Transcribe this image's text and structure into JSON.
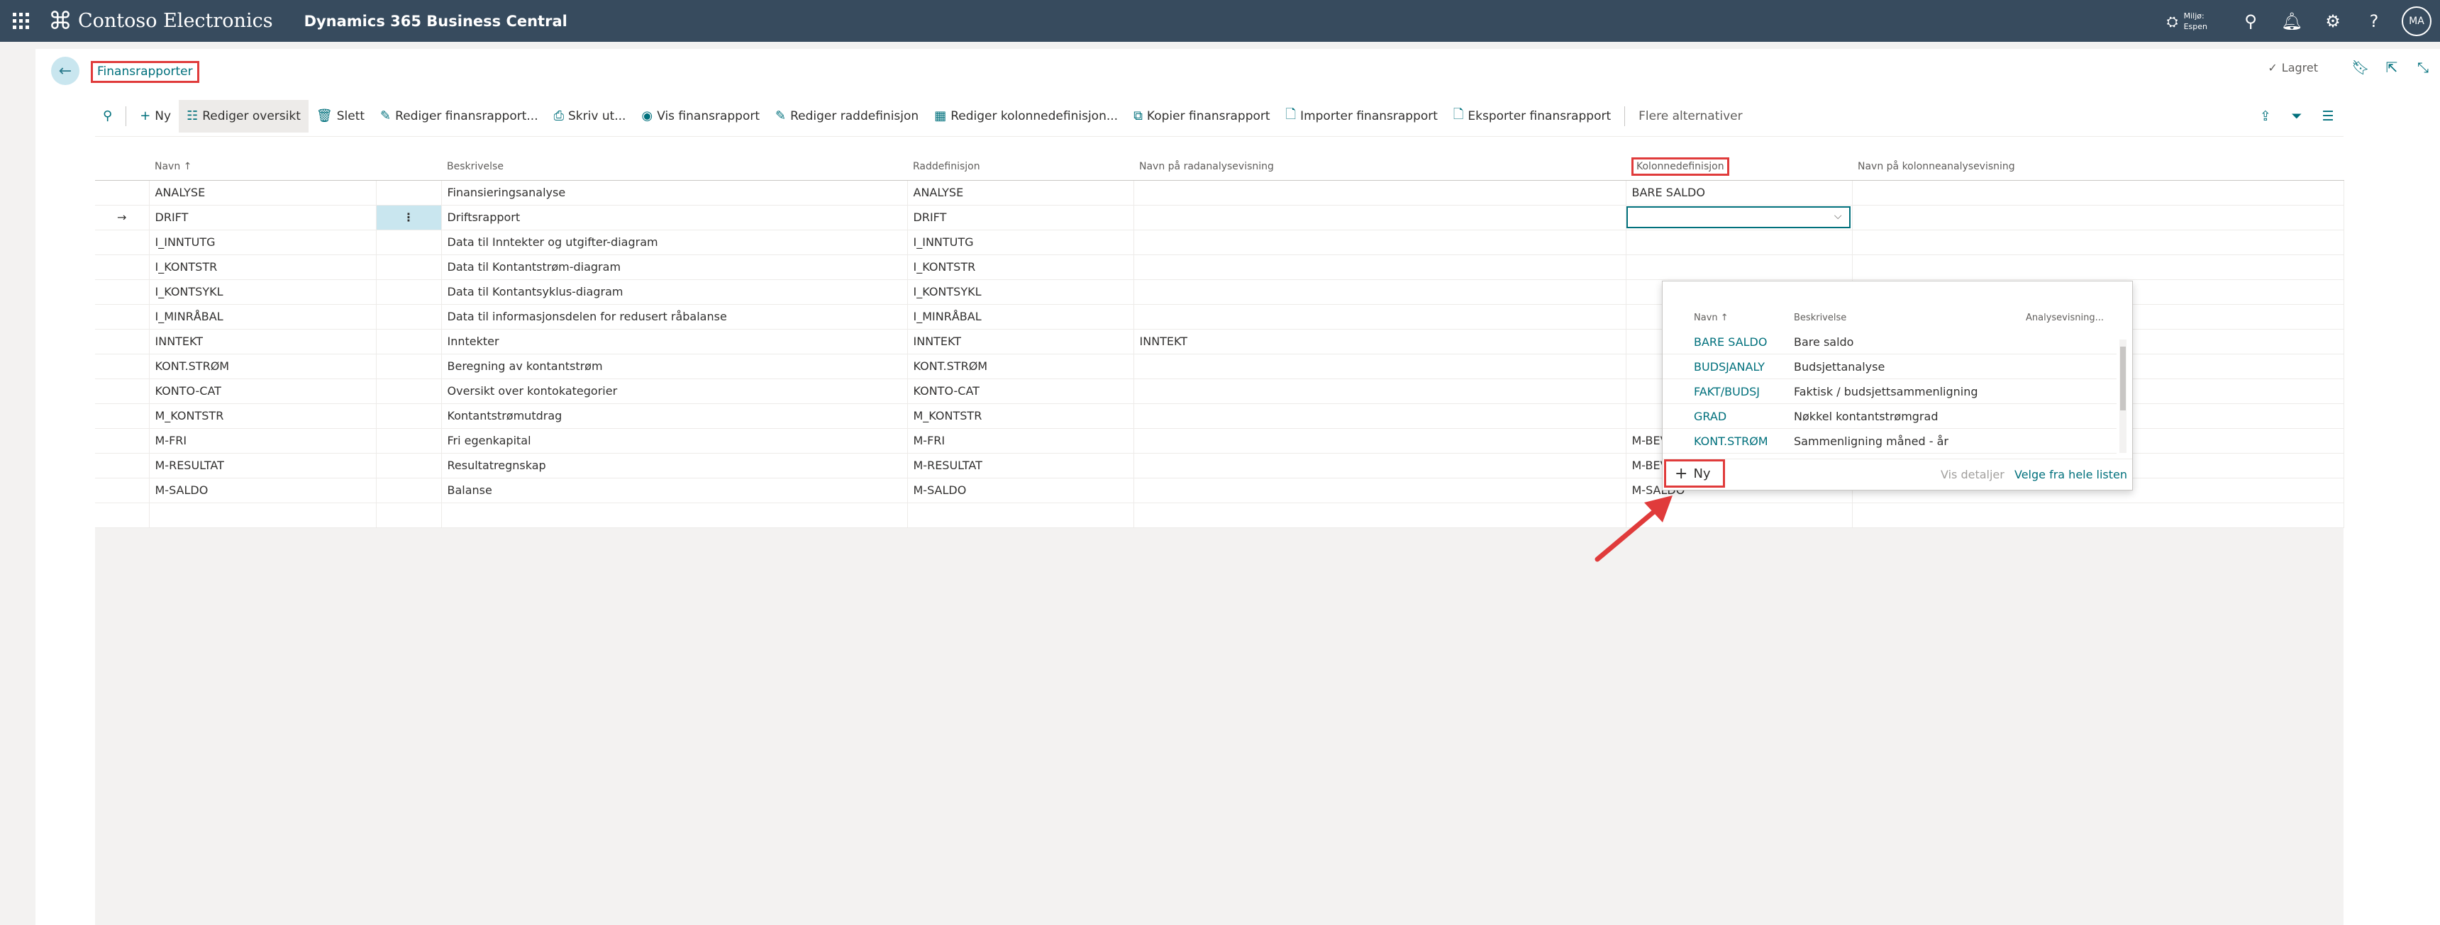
{
  "topbar": {
    "company": "Contoso Electronics",
    "product": "Dynamics 365 Business Central",
    "environment_line1": "Miljø:",
    "environment_line2": "Espen",
    "avatar_initials": "MA"
  },
  "header": {
    "title": "Finansrapporter",
    "saved_label": "Lagret"
  },
  "actions": {
    "new": "Ny",
    "edit_list": "Rediger oversikt",
    "delete": "Slett",
    "edit_report": "Rediger finansrapport...",
    "print": "Skriv ut...",
    "view_report": "Vis finansrapport",
    "edit_row_def": "Rediger raddefinisjon",
    "edit_col_def": "Rediger kolonnedefinisjon...",
    "copy_report": "Kopier finansrapport",
    "import_report": "Importer finansrapport",
    "export_report": "Eksporter finansrapport",
    "more_options": "Flere alternativer"
  },
  "grid": {
    "columns": {
      "name": "Navn ↑",
      "description": "Beskrivelse",
      "row_def": "Raddefinisjon",
      "row_analysis": "Navn på radanalysevisning",
      "col_def": "Kolonnedefinisjon",
      "col_analysis": "Navn på kolonneanalysevisning"
    },
    "rows": [
      {
        "name": "ANALYSE",
        "description": "Finansieringsanalyse",
        "row_def": "ANALYSE",
        "row_analysis": "",
        "col_def": "BARE SALDO",
        "col_analysis": ""
      },
      {
        "name": "DRIFT",
        "description": "Driftsrapport",
        "row_def": "DRIFT",
        "row_analysis": "",
        "col_def": "",
        "col_analysis": ""
      },
      {
        "name": "I_INNTUTG",
        "description": "Data til Inntekter og utgifter-diagram",
        "row_def": "I_INNTUTG",
        "row_analysis": "",
        "col_def": "",
        "col_analysis": ""
      },
      {
        "name": "I_KONTSTR",
        "description": "Data til Kontantstrøm-diagram",
        "row_def": "I_KONTSTR",
        "row_analysis": "",
        "col_def": "",
        "col_analysis": ""
      },
      {
        "name": "I_KONTSYKL",
        "description": "Data til Kontantsyklus-diagram",
        "row_def": "I_KONTSYKL",
        "row_analysis": "",
        "col_def": "",
        "col_analysis": ""
      },
      {
        "name": "I_MINRÅBAL",
        "description": "Data til informasjonsdelen for redusert råbalanse",
        "row_def": "I_MINRÅBAL",
        "row_analysis": "",
        "col_def": "",
        "col_analysis": ""
      },
      {
        "name": "INNTEKT",
        "description": "Inntekter",
        "row_def": "INNTEKT",
        "row_analysis": "INNTEKT",
        "col_def": "",
        "col_analysis": ""
      },
      {
        "name": "KONT.STRØM",
        "description": "Beregning av kontantstrøm",
        "row_def": "KONT.STRØM",
        "row_analysis": "",
        "col_def": "",
        "col_analysis": ""
      },
      {
        "name": "KONTO-CAT",
        "description": "Oversikt over kontokategorier",
        "row_def": "KONTO-CAT",
        "row_analysis": "",
        "col_def": "",
        "col_analysis": ""
      },
      {
        "name": "M_KONTSTR",
        "description": "Kontantstrømutdrag",
        "row_def": "M_KONTSTR",
        "row_analysis": "",
        "col_def": "",
        "col_analysis": ""
      },
      {
        "name": "M-FRI",
        "description": "Fri egenkapital",
        "row_def": "M-FRI",
        "row_analysis": "",
        "col_def": "M-BEVEG.",
        "col_analysis": ""
      },
      {
        "name": "M-RESULTAT",
        "description": "Resultatregnskap",
        "row_def": "M-RESULTAT",
        "row_analysis": "",
        "col_def": "M-BEVEG.",
        "col_analysis": ""
      },
      {
        "name": "M-SALDO",
        "description": "Balanse",
        "row_def": "M-SALDO",
        "row_analysis": "",
        "col_def": "M-SALDO",
        "col_analysis": ""
      }
    ]
  },
  "lookup": {
    "columns": {
      "name": "Navn ↑",
      "description": "Beskrivelse",
      "analysis": "Analysevisning..."
    },
    "rows": [
      {
        "name": "BARE SALDO",
        "description": "Bare saldo"
      },
      {
        "name": "BUDSJANALY",
        "description": "Budsjettanalyse"
      },
      {
        "name": "FAKT/BUDSJ",
        "description": "Faktisk / budsjettsammenligning"
      },
      {
        "name": "GRAD",
        "description": "Nøkkel kontantstrømgrad"
      },
      {
        "name": "KONT.STRØM",
        "description": "Sammenligning måned - år"
      }
    ],
    "new_label": "Ny",
    "details_label": "Vis detaljer",
    "full_list_label": "Velge fra hele listen"
  }
}
